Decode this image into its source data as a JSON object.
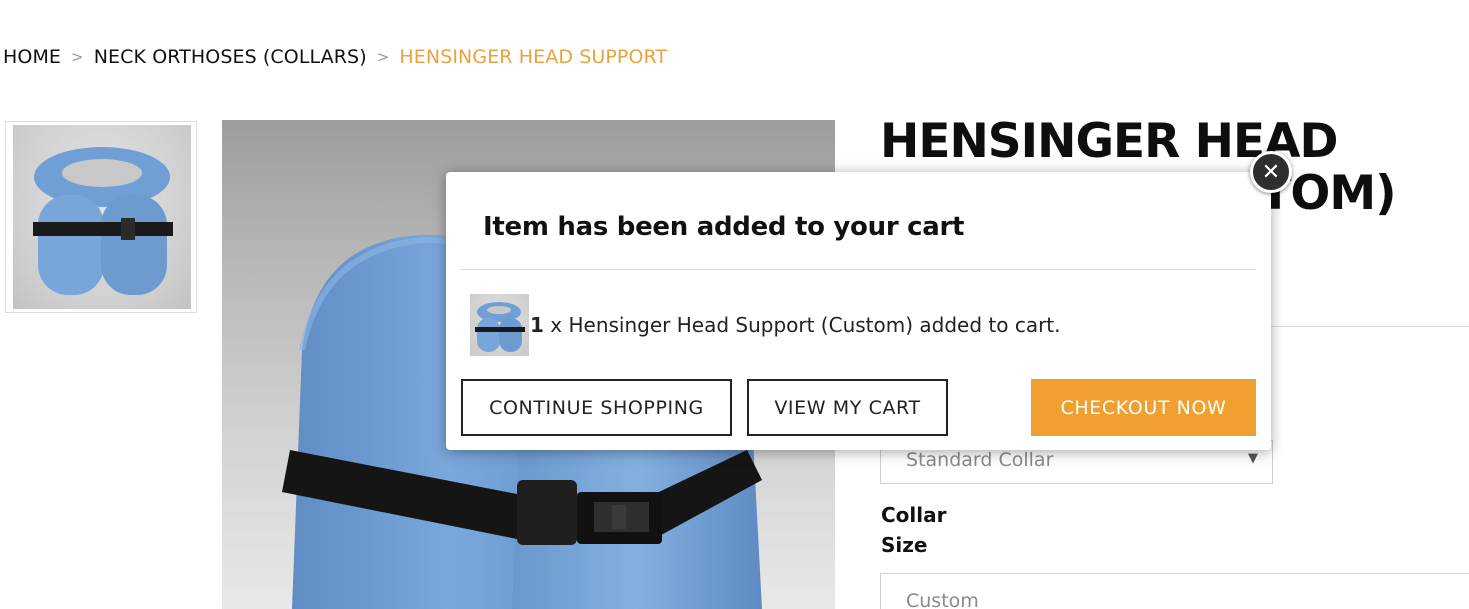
{
  "breadcrumb": {
    "home": "HOME",
    "category": "NECK ORTHOSES (COLLARS)",
    "current": "HENSINGER HEAD SUPPORT",
    "separator": ">"
  },
  "product": {
    "title_line1": "HENSINGER HEAD",
    "title_line2": "SUPPORT (CUSTOM)",
    "collar_select_value": "Standard Collar",
    "collar_size_label_line1": "Collar",
    "collar_size_label_line2": "Size",
    "collar_size_value": "Custom"
  },
  "modal": {
    "title": "Item has been added to your cart",
    "quantity": "1",
    "message": " x Hensinger Head Support (Custom) added to cart.",
    "continue_label": "CONTINUE SHOPPING",
    "view_cart_label": "VIEW MY CART",
    "checkout_label": "CHECKOUT NOW",
    "close_symbol": "✕"
  },
  "colors": {
    "accent": "#f0a030",
    "breadcrumb_current": "#e8a23e",
    "product_blue": "#6f9fd4"
  },
  "icons": {
    "select_arrow": "▼",
    "close": "close-icon"
  }
}
